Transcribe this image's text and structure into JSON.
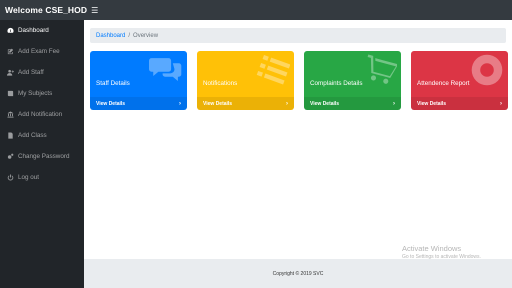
{
  "app": {
    "title": "Welcome CSE_HOD",
    "menu_icon": "hamburger-icon"
  },
  "sidebar": {
    "items": [
      {
        "label": "Dashboard",
        "icon": "dashboard-icon",
        "active": true
      },
      {
        "label": "Add Exam Fee",
        "icon": "edit-icon"
      },
      {
        "label": "Add Staff",
        "icon": "user-plus-icon"
      },
      {
        "label": "My Subjects",
        "icon": "book-icon"
      },
      {
        "label": "Add Notification",
        "icon": "bank-icon"
      },
      {
        "label": "Add Class",
        "icon": "file-icon"
      },
      {
        "label": "Change Password",
        "icon": "cogs-icon"
      },
      {
        "label": "Log out",
        "icon": "power-icon"
      }
    ]
  },
  "breadcrumb": {
    "home": "Dashboard",
    "separator": "/",
    "current": "Overview"
  },
  "cards": [
    {
      "title": "Staff Details",
      "footer": "View Details",
      "color": "#007bff",
      "icon": "comments-icon"
    },
    {
      "title": "Notifications",
      "footer": "View Details",
      "color": "#ffc107",
      "icon": "list-icon"
    },
    {
      "title": "Complaints Details",
      "footer": "View Details",
      "color": "#28a745",
      "icon": "shopping-cart-icon"
    },
    {
      "title": "Attendence Report",
      "footer": "View Details",
      "color": "#dc3545",
      "icon": "life-ring-icon"
    }
  ],
  "footer": {
    "copyright": "Copyright © 2019 SVC"
  },
  "watermark": {
    "line1": "Activate Windows",
    "line2": "Go to Settings to activate Windows."
  }
}
